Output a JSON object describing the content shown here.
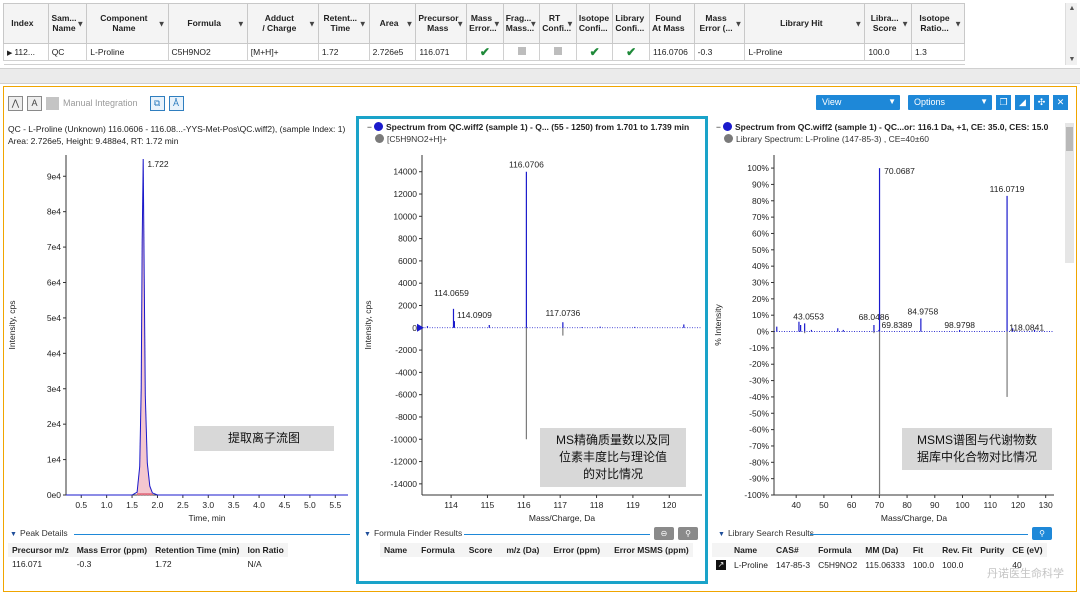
{
  "results_table": {
    "columns": [
      "Index",
      "Sam...\nName",
      "Component\nName",
      "Formula",
      "Adduct\n/ Charge",
      "Retent...\nTime",
      "Area",
      "Precursor\nMass",
      "Mass\nError...",
      "Frag...\nMass...",
      "RT\nConfi...",
      "Isotope\nConfi...",
      "Library\nConfi...",
      "Found\nAt Mass",
      "Mass\nError (...",
      "Library Hit",
      "Libra...\nScore",
      "Isotope\nRatio..."
    ],
    "row": {
      "index": "112...",
      "sample_name": "QC",
      "component_name": "L-Proline",
      "formula": "C5H9NO2",
      "adduct": "[M+H]+",
      "retention_time": "1.72",
      "area": "2.726e5",
      "precursor_mass": "116.071",
      "mass_error_flag": "✔",
      "frag_mass_flag": "grey",
      "rt_conf_flag": "grey",
      "isotope_conf_flag": "✔",
      "library_conf_flag": "✔",
      "found_at_mass": "116.0706",
      "mass_error_ppm": "-0.3",
      "library_hit": "L-Proline",
      "library_score": "100.0",
      "isotope_ratio": "1.3"
    }
  },
  "toolbar": {
    "manual_integration": "Manual Integration",
    "view_label": "View",
    "options_label": "Options"
  },
  "xic": {
    "title_line1": "QC - L-Proline (Unknown) 116.0606 - 116.08...-YYS-Met-Pos\\QC.wiff2), (sample Index: 1)",
    "title_line2": "Area: 2.726e5, Height: 9.488e4, RT: 1.72 min",
    "overlay": "提取离子流图"
  },
  "ms_spectrum": {
    "title": "Spectrum from QC.wiff2 (sample 1) - Q... (55 - 1250) from 1.701 to 1.739 min",
    "subtitle": "[C5H9NO2+H]+",
    "overlay_line1": "MS精确质量数以及同",
    "overlay_line2": "位素丰度比与理论值",
    "overlay_line3": "的对比情况"
  },
  "msms_spectrum": {
    "title": "Spectrum from QC.wiff2 (sample 1) - QC...or: 116.1 Da, +1, CE: 35.0, CES: 15.0",
    "subtitle": "Library Spectrum: L-Proline (147-85-3) , CE=40±60",
    "overlay_line1": "MSMS谱图与代谢物数",
    "overlay_line2": "据库中化合物对比情况"
  },
  "peak_details": {
    "title": "Peak Details",
    "headers": [
      "Precursor m/z",
      "Mass Error (ppm)",
      "Retention Time (min)",
      "Ion Ratio"
    ],
    "row": [
      "116.071",
      "-0.3",
      "1.72",
      "N/A"
    ]
  },
  "formula_finder": {
    "title": "Formula Finder Results",
    "headers": [
      "Name",
      "Formula",
      "Score",
      "m/z (Da)",
      "Error (ppm)",
      "Error MSMS (ppm)"
    ]
  },
  "library_search": {
    "title": "Library Search Results",
    "headers": [
      "Name",
      "CAS#",
      "Formula",
      "MM (Da)",
      "Fit",
      "Rev. Fit",
      "Purity",
      "CE (eV)"
    ],
    "row": [
      "L-Proline",
      "147-85-3",
      "C5H9NO2",
      "115.06333",
      "100.0",
      "100.0",
      "",
      "40"
    ]
  },
  "watermark": "丹诺医生命科学",
  "chart_data": [
    {
      "type": "line",
      "name": "xic",
      "xlabel": "Time, min",
      "ylabel": "Intensity, cps",
      "xlim": [
        0.2,
        5.75
      ],
      "ylim": [
        0,
        96000
      ],
      "xticks": [
        0.5,
        1.0,
        1.5,
        2.0,
        2.5,
        3.0,
        3.5,
        4.0,
        4.5,
        5.0,
        5.5
      ],
      "xtick_labels": [
        "0.5",
        "1.0",
        "1.5",
        "2.0",
        "2.5",
        "3.0",
        "3.5",
        "4.0",
        "4.5",
        "5.0",
        "5.5"
      ],
      "yticks": [
        0,
        10000,
        20000,
        30000,
        40000,
        50000,
        60000,
        70000,
        80000,
        90000
      ],
      "ytick_labels": [
        "0e0",
        "1e4",
        "2e4",
        "3e4",
        "4e4",
        "5e4",
        "6e4",
        "7e4",
        "8e4",
        "9e4"
      ],
      "x": [
        0.2,
        1.5,
        1.6,
        1.65,
        1.68,
        1.7,
        1.72,
        1.74,
        1.76,
        1.8,
        1.85,
        1.9,
        2.0,
        5.75
      ],
      "y": [
        0,
        0,
        800,
        8000,
        30000,
        72000,
        94880,
        62000,
        28000,
        9000,
        2500,
        600,
        0,
        0
      ],
      "peak_label": "1.722",
      "peak_x": 1.722,
      "peak_y": 94880
    },
    {
      "type": "bar",
      "name": "ms",
      "xlabel": "Mass/Charge, Da",
      "ylabel": "Intensity, cps",
      "xlim": [
        113.2,
        120.9
      ],
      "ylim": [
        -15000,
        15500
      ],
      "xticks": [
        114,
        115,
        116,
        117,
        118,
        119,
        120
      ],
      "xtick_labels": [
        "114",
        "115",
        "116",
        "117",
        "118",
        "119",
        "120"
      ],
      "yticks": [
        -14000,
        -12000,
        -10000,
        -8000,
        -6000,
        -4000,
        -2000,
        0,
        2000,
        4000,
        6000,
        8000,
        10000,
        12000,
        14000
      ],
      "ytick_labels": [
        "-14000",
        "-12000",
        "-10000",
        "-8000",
        "-6000",
        "-4000",
        "-2000",
        "0",
        "2000",
        "4000",
        "6000",
        "8000",
        "10000",
        "12000",
        "14000"
      ],
      "positive": [
        {
          "x": 113.35,
          "y": 150
        },
        {
          "x": 114.0659,
          "y": 1700,
          "label": "114.0659"
        },
        {
          "x": 114.0909,
          "y": 600,
          "label": "114.0909"
        },
        {
          "x": 115.05,
          "y": 250
        },
        {
          "x": 116.0706,
          "y": 14000,
          "label": "116.0706"
        },
        {
          "x": 117.0736,
          "y": 500,
          "label": "117.0736"
        },
        {
          "x": 117.6,
          "y": 60
        },
        {
          "x": 118.1,
          "y": 100
        },
        {
          "x": 119.05,
          "y": 80
        },
        {
          "x": 120.4,
          "y": 300
        }
      ],
      "negative": [
        {
          "x": 116.0706,
          "y": -10000
        },
        {
          "x": 117.0736,
          "y": -700
        }
      ]
    },
    {
      "type": "bar",
      "name": "msms",
      "xlabel": "Mass/Charge, Da",
      "ylabel": "% Intensity",
      "xlim": [
        32,
        133
      ],
      "ylim": [
        -100,
        108
      ],
      "xticks": [
        40,
        50,
        60,
        70,
        80,
        90,
        100,
        110,
        120,
        130
      ],
      "xtick_labels": [
        "40",
        "50",
        "60",
        "70",
        "80",
        "90",
        "100",
        "110",
        "120",
        "130"
      ],
      "yticks": [
        -100,
        -90,
        -80,
        -70,
        -60,
        -50,
        -40,
        -30,
        -20,
        -10,
        0,
        10,
        20,
        30,
        40,
        50,
        60,
        70,
        80,
        90,
        100
      ],
      "ytick_labels": [
        "-100%",
        "-90%",
        "-80%",
        "-70%",
        "-60%",
        "-50%",
        "-40%",
        "-30%",
        "-20%",
        "-10%",
        "0%",
        "10%",
        "20%",
        "30%",
        "40%",
        "50%",
        "60%",
        "70%",
        "80%",
        "90%",
        "100%"
      ],
      "positive": [
        {
          "x": 33,
          "y": 3
        },
        {
          "x": 41.0,
          "y": 6
        },
        {
          "x": 41.6,
          "y": 4
        },
        {
          "x": 43.0553,
          "y": 5,
          "label": "43.0553"
        },
        {
          "x": 45.5,
          "y": 1
        },
        {
          "x": 55.0,
          "y": 2
        },
        {
          "x": 57.0,
          "y": 1
        },
        {
          "x": 68.0486,
          "y": 4,
          "label": "68.0486"
        },
        {
          "x": 70.0687,
          "y": 100,
          "label": "70.0687"
        },
        {
          "x": 69.8389,
          "y": 1,
          "label": "69.8389"
        },
        {
          "x": 84.9758,
          "y": 8,
          "label": "84.9758"
        },
        {
          "x": 98.9798,
          "y": 1,
          "label": "98.9798"
        },
        {
          "x": 116.0719,
          "y": 83,
          "label": "116.0719"
        },
        {
          "x": 118.0841,
          "y": 2,
          "label": "118.0841"
        },
        {
          "x": 126.0,
          "y": 1
        }
      ],
      "negative": [
        {
          "x": 70.0687,
          "y": -100
        },
        {
          "x": 116.0719,
          "y": -40
        },
        {
          "x": 43.0553,
          "y": -1
        },
        {
          "x": 68.0486,
          "y": -1
        }
      ]
    }
  ]
}
